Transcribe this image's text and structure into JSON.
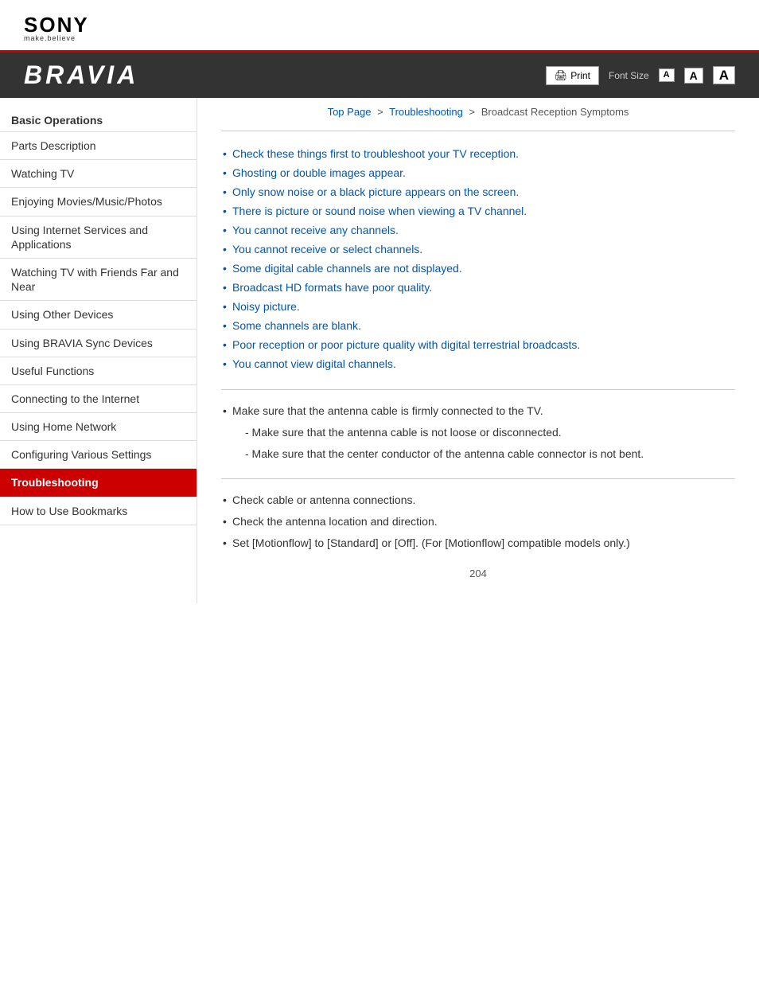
{
  "header": {
    "sony_text": "SONY",
    "sony_tagline": "make.believe",
    "bravia_title": "BRAVIA",
    "print_label": "Print",
    "font_size_label": "Font Size",
    "font_small": "A",
    "font_medium": "A",
    "font_large": "A"
  },
  "breadcrumb": {
    "top_page": "Top Page",
    "sep1": ">",
    "troubleshooting": "Troubleshooting",
    "sep2": ">",
    "current": "Broadcast Reception Symptoms"
  },
  "sidebar": {
    "section_header": "Basic Operations",
    "items": [
      {
        "label": "Parts Description",
        "active": false
      },
      {
        "label": "Watching TV",
        "active": false
      },
      {
        "label": "Enjoying Movies/Music/Photos",
        "active": false
      },
      {
        "label": "Using Internet Services and Applications",
        "active": false
      },
      {
        "label": "Watching TV with Friends Far and Near",
        "active": false
      },
      {
        "label": "Using Other Devices",
        "active": false
      },
      {
        "label": "Using BRAVIA Sync Devices",
        "active": false
      },
      {
        "label": "Useful Functions",
        "active": false
      },
      {
        "label": "Connecting to the Internet",
        "active": false
      },
      {
        "label": "Using Home Network",
        "active": false
      },
      {
        "label": "Configuring Various Settings",
        "active": false
      },
      {
        "label": "Troubleshooting",
        "active": true
      },
      {
        "label": "How to Use Bookmarks",
        "active": false
      }
    ]
  },
  "links": [
    "Check these things first to troubleshoot your TV reception.",
    "Ghosting or double images appear.",
    "Only snow noise or a black picture appears on the screen.",
    "There is picture or sound noise when viewing a TV channel.",
    "You cannot receive any channels.",
    "You cannot receive or select channels.",
    "Some digital cable channels are not displayed.",
    "Broadcast HD formats have poor quality.",
    "Noisy picture.",
    "Some channels are blank.",
    "Poor reception or poor picture quality with digital terrestrial broadcasts.",
    "You cannot view digital channels."
  ],
  "section1": {
    "bullet": "Make sure that the antenna cable is firmly connected to the TV.",
    "sub1": "- Make sure that the antenna cable is not loose or disconnected.",
    "sub2": "- Make sure that the center conductor of the antenna cable connector is not bent."
  },
  "section2": {
    "items": [
      "Check cable or antenna connections.",
      "Check the antenna location and direction.",
      "Set [Motionflow] to [Standard] or [Off]. (For [Motionflow] compatible models only.)"
    ]
  },
  "page_number": "204"
}
